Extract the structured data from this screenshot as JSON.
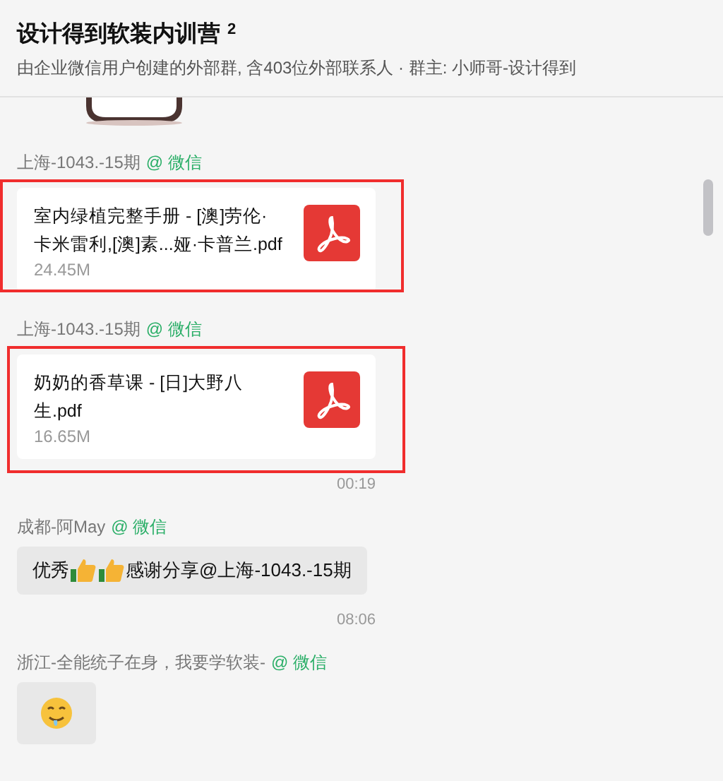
{
  "header": {
    "title": "设计得到软装内训营",
    "badge": "2",
    "subtitle": "由企业微信用户创建的外部群, 含403位外部联系人 · 群主: 小师哥-设计得到"
  },
  "messages": [
    {
      "kind": "sticker"
    },
    {
      "kind": "file",
      "sender": "上海-1043.-15期",
      "source": "@ 微信",
      "name": "室内绿植完整手册 - [澳]劳伦·卡米雷利,[澳]素...娅·卡普兰.pdf",
      "size": "24.45M",
      "highlighted": true
    },
    {
      "kind": "file",
      "sender": "上海-1043.-15期",
      "source": "@ 微信",
      "name": "奶奶的香草课 - [日]大野八生.pdf",
      "size": "16.65M",
      "highlighted": true
    },
    {
      "kind": "time",
      "text": "00:19"
    },
    {
      "kind": "text",
      "sender": "成都-阿May",
      "source": "@ 微信",
      "parts": [
        {
          "kind": "text",
          "text": "优秀"
        },
        {
          "kind": "thumbs_up"
        },
        {
          "kind": "thumbs_up"
        },
        {
          "kind": "text",
          "text": "感谢分享@上海-1043.-15期"
        }
      ]
    },
    {
      "kind": "time",
      "text": "08:06"
    },
    {
      "kind": "text",
      "sender": "浙江-全能统子在身，我要学软装-",
      "source": "@ 微信",
      "parts": [
        {
          "kind": "drool_face"
        }
      ]
    }
  ]
}
